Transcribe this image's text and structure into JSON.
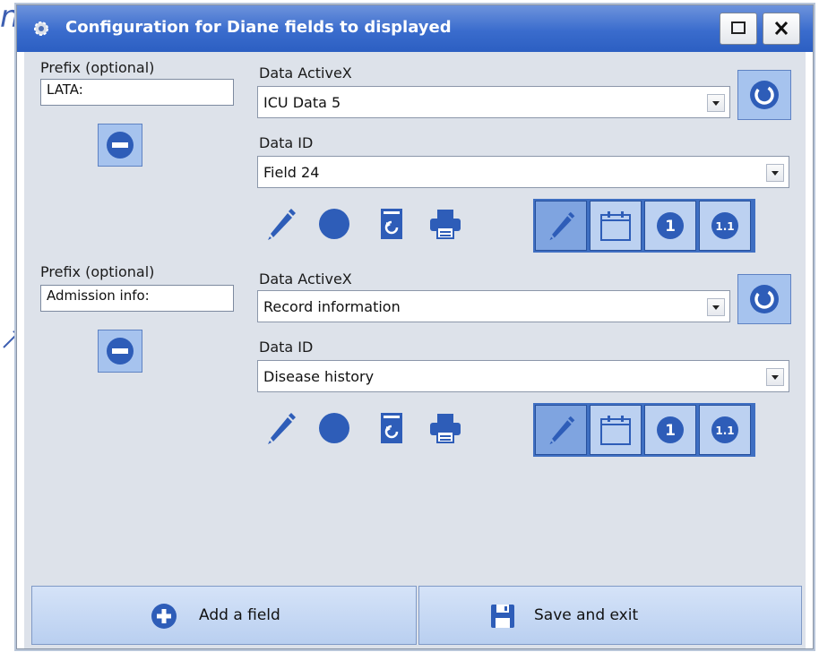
{
  "window": {
    "title": "Configuration for Diane fields to displayed",
    "titlebar_color": "#3a6ccd",
    "icons": [
      "gear-icon",
      "maximize-icon",
      "close-icon"
    ]
  },
  "outside": {
    "glyph": "n",
    "arrow": "arrow-icon"
  },
  "fields": [
    {
      "prefix_label": "Prefix (optional)",
      "prefix_value": "LATA:",
      "activex_label": "Data ActiveX",
      "activex_value": "ICU Data 5",
      "dataid_label": "Data ID",
      "dataid_value": "Field 24",
      "tool_icons": [
        "pencil-icon",
        "circle-icon",
        "refresh-doc-icon",
        "printer-icon"
      ],
      "mode_buttons": [
        "pencil-icon",
        "calendar-icon",
        "number-1-icon",
        "number-1-1-icon"
      ],
      "active_mode": "pencil"
    },
    {
      "prefix_label": "Prefix (optional)",
      "prefix_value": "Admission info:",
      "activex_label": "Data ActiveX",
      "activex_value": "Record information",
      "dataid_label": "Data ID",
      "dataid_value": "Disease history",
      "tool_icons": [
        "pencil-icon",
        "circle-icon",
        "refresh-doc-icon",
        "printer-icon"
      ],
      "mode_buttons": [
        "pencil-icon",
        "calendar-icon",
        "number-1-icon",
        "number-1-1-icon"
      ],
      "active_mode": "pencil"
    }
  ],
  "mode_labels": {
    "one": "1",
    "one_one": "1.1"
  },
  "footer": {
    "add_label": "Add a field",
    "save_label": "Save and exit"
  },
  "colors": {
    "accent": "#2e5db8",
    "button_bg": "#a6c3ee",
    "panel_bg": "#dde2ea"
  }
}
